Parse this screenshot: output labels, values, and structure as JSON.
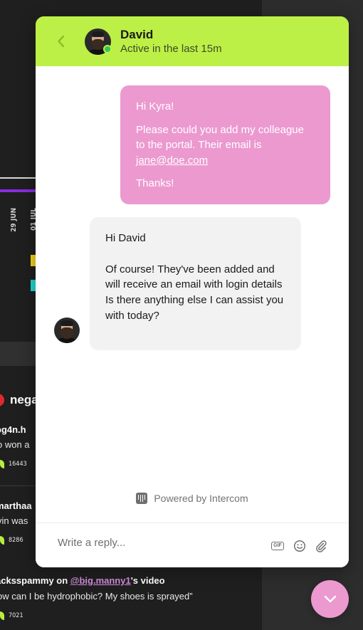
{
  "background": {
    "axis_labels": [
      "29 JUN",
      "01 JUL"
    ],
    "section_title": "nega",
    "feed": [
      {
        "user": "og4n.h",
        "mention": "",
        "suffix": "",
        "text": "o won a",
        "count": "16443"
      },
      {
        "user": "marthaa",
        "mention": "",
        "suffix": "",
        "text": "vin was",
        "count": "8286"
      },
      {
        "user": "acksspammy on ",
        "mention": "@big.manny1",
        "suffix": "'s video",
        "text": "ow can I be hydrophobic? My shoes is sprayed”",
        "count": "7021"
      }
    ]
  },
  "messenger": {
    "header": {
      "name": "David",
      "status": "Active in the last 15m",
      "accent": "#bdf046"
    },
    "outgoing": {
      "greeting": "Hi Kyra!",
      "body": "Please could you add my colleague to the portal. Their email is ",
      "email": "jane@doe.com",
      "signoff": "Thanks!",
      "color": "#ec99d0"
    },
    "incoming": {
      "greeting": "Hi David",
      "line1": "Of course! They've been added and will receive an email with login details",
      "line2": "Is there anything else I can assist you with today?"
    },
    "powered_by": "Powered by Intercom",
    "composer": {
      "placeholder": "Write a reply..."
    }
  },
  "icons": [
    "chevron-left-icon",
    "gif-icon",
    "emoji-icon",
    "paperclip-icon",
    "intercom-logo-icon",
    "chevron-down-icon"
  ]
}
